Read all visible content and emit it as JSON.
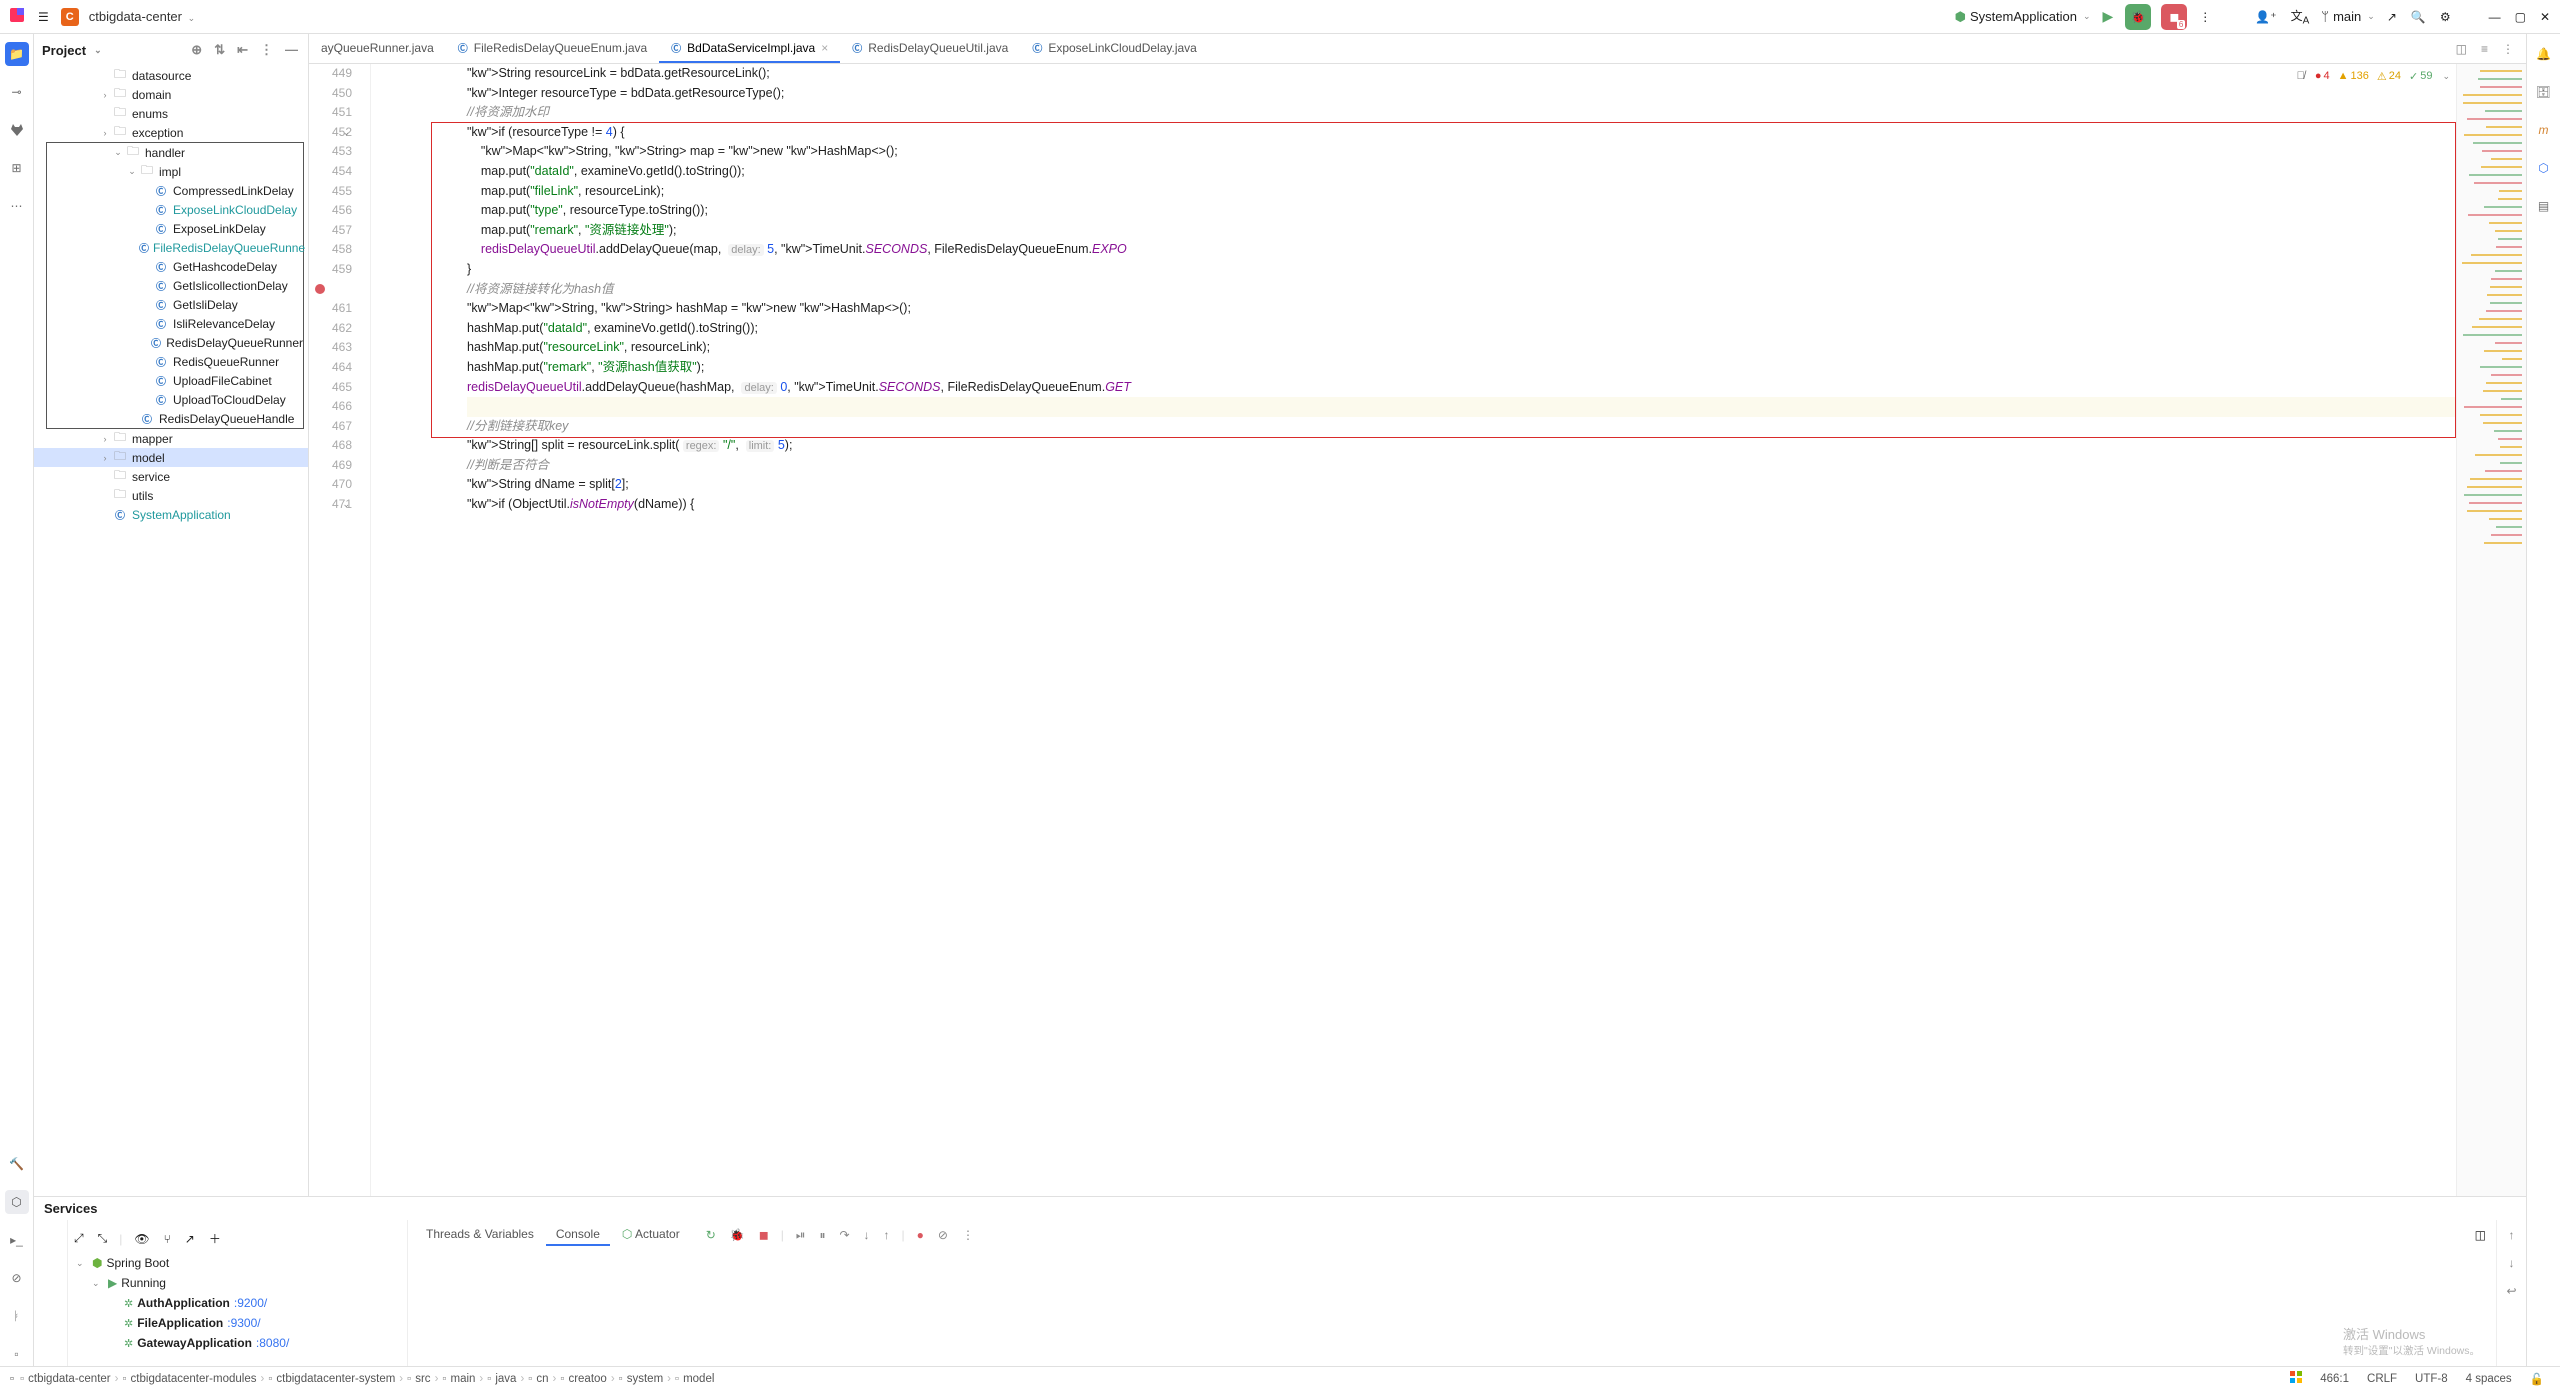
{
  "topbar": {
    "project_initial": "C",
    "project_name": "ctbigdata-center",
    "run_config": "SystemApplication",
    "stop_badge": "6",
    "branch": "main"
  },
  "project_panel": {
    "title": "Project",
    "tree": [
      {
        "indent": 4,
        "arrow": "",
        "icon": "folder",
        "label": "datasource"
      },
      {
        "indent": 4,
        "arrow": "›",
        "icon": "folder",
        "label": "domain"
      },
      {
        "indent": 4,
        "arrow": "",
        "icon": "folder",
        "label": "enums"
      },
      {
        "indent": 4,
        "arrow": "›",
        "icon": "folder",
        "label": "exception"
      }
    ],
    "boxed": [
      {
        "indent": 4,
        "arrow": "⌄",
        "icon": "folder",
        "label": "handler"
      },
      {
        "indent": 5,
        "arrow": "⌄",
        "icon": "folder",
        "label": "impl"
      },
      {
        "indent": 6,
        "arrow": "",
        "icon": "class",
        "label": "CompressedLinkDelay"
      },
      {
        "indent": 6,
        "arrow": "",
        "icon": "class",
        "label": "ExposeLinkCloudDelay",
        "teal": true
      },
      {
        "indent": 6,
        "arrow": "",
        "icon": "class",
        "label": "ExposeLinkDelay"
      },
      {
        "indent": 6,
        "arrow": "",
        "icon": "class",
        "label": "FileRedisDelayQueueRunne",
        "teal": true
      },
      {
        "indent": 6,
        "arrow": "",
        "icon": "class",
        "label": "GetHashcodeDelay"
      },
      {
        "indent": 6,
        "arrow": "",
        "icon": "class",
        "label": "GetIslicollectionDelay"
      },
      {
        "indent": 6,
        "arrow": "",
        "icon": "class",
        "label": "GetIsliDelay"
      },
      {
        "indent": 6,
        "arrow": "",
        "icon": "class",
        "label": "IsliRelevanceDelay"
      },
      {
        "indent": 6,
        "arrow": "",
        "icon": "class",
        "label": "RedisDelayQueueRunner"
      },
      {
        "indent": 6,
        "arrow": "",
        "icon": "class",
        "label": "RedisQueueRunner"
      },
      {
        "indent": 6,
        "arrow": "",
        "icon": "class",
        "label": "UploadFileCabinet"
      },
      {
        "indent": 6,
        "arrow": "",
        "icon": "class",
        "label": "UploadToCloudDelay"
      },
      {
        "indent": 5,
        "arrow": "",
        "icon": "class",
        "label": "RedisDelayQueueHandle"
      }
    ],
    "after": [
      {
        "indent": 4,
        "arrow": "›",
        "icon": "folder",
        "label": "mapper"
      },
      {
        "indent": 4,
        "arrow": "›",
        "icon": "folder",
        "label": "model",
        "sel": true
      },
      {
        "indent": 4,
        "arrow": "",
        "icon": "folder",
        "label": "service"
      },
      {
        "indent": 4,
        "arrow": "",
        "icon": "folder",
        "label": "utils"
      },
      {
        "indent": 4,
        "arrow": "",
        "icon": "class",
        "label": "SystemApplication",
        "teal": true
      }
    ]
  },
  "tabs": [
    {
      "label": "ayQueueRunner.java",
      "partial": true
    },
    {
      "label": "FileRedisDelayQueueEnum.java"
    },
    {
      "label": "BdDataServiceImpl.java",
      "active": true,
      "close": true
    },
    {
      "label": "RedisDelayQueueUtil.java"
    },
    {
      "label": "ExposeLinkCloudDelay.java"
    }
  ],
  "inspections": {
    "err": "4",
    "warn_strong": "136",
    "warn": "24",
    "ok": "59"
  },
  "gutter_start": 449,
  "gutter_count": 23,
  "fold_lines": [
    452,
    471
  ],
  "bp_line": 460,
  "code_lines": [
    "String resourceLink = bdData.getResourceLink();",
    "Integer resourceType = bdData.getResourceType();",
    "//将资源加水印",
    "if (resourceType != 4) {",
    "    Map<String, String> map = new HashMap<>();",
    "    map.put(\"dataId\", examineVo.getId().toString());",
    "    map.put(\"fileLink\", resourceLink);",
    "    map.put(\"type\", resourceType.toString());",
    "    map.put(\"remark\", \"资源链接处理\");",
    "    redisDelayQueueUtil.addDelayQueue(map,  delay: 5, TimeUnit.SECONDS, FileRedisDelayQueueEnum.EXPO",
    "}",
    "//将资源链接转化为hash值",
    "Map<String, String> hashMap = new HashMap<>();",
    "hashMap.put(\"dataId\", examineVo.getId().toString());",
    "hashMap.put(\"resourceLink\", resourceLink);",
    "hashMap.put(\"remark\", \"资源hash值获取\");",
    "redisDelayQueueUtil.addDelayQueue(hashMap,  delay: 0, TimeUnit.SECONDS, FileRedisDelayQueueEnum.GET",
    "",
    "//分割链接获取key",
    "String[] split = resourceLink.split( regex: \"/\",  limit: 5);",
    "//判断是否符合",
    "String dName = split[2];",
    "if (ObjectUtil.isNotEmpty(dName)) {"
  ],
  "services": {
    "title": "Services",
    "tabs": [
      "Threads & Variables",
      "Console",
      "Actuator"
    ],
    "active_tab": 1,
    "tree": [
      {
        "indent": 0,
        "arrow": "⌄",
        "icon": "spring",
        "label": "Spring Boot"
      },
      {
        "indent": 1,
        "arrow": "⌄",
        "icon": "play",
        "label": "Running"
      },
      {
        "indent": 2,
        "arrow": "",
        "icon": "leaf",
        "label": "AuthApplication",
        "port": ":9200/"
      },
      {
        "indent": 2,
        "arrow": "",
        "icon": "leaf",
        "label": "FileApplication",
        "port": ":9300/"
      },
      {
        "indent": 2,
        "arrow": "",
        "icon": "leaf",
        "label": "GatewayApplication",
        "port": ":8080/"
      }
    ]
  },
  "breadcrumbs": [
    "ctbigdata-center",
    "ctbigdatacenter-modules",
    "ctbigdatacenter-system",
    "src",
    "main",
    "java",
    "cn",
    "creatoo",
    "system",
    "model"
  ],
  "status": {
    "pos": "466:1",
    "eol": "CRLF",
    "enc": "UTF-8",
    "indent": "4 spaces"
  },
  "activate": {
    "title": "激活 Windows",
    "sub": "转到\"设置\"以激活 Windows。"
  }
}
